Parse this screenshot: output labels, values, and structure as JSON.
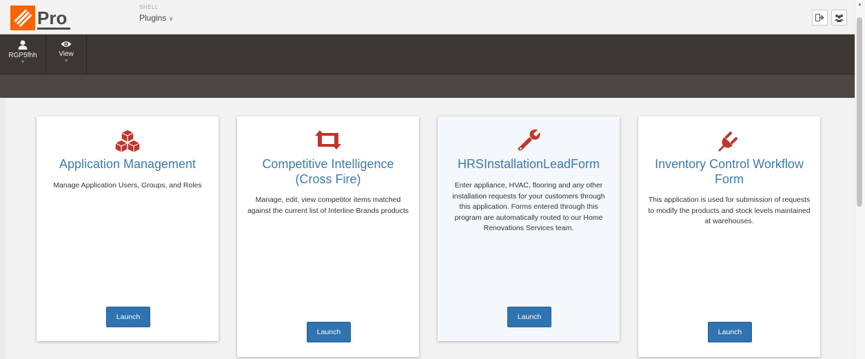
{
  "header": {
    "shell_label": "SHELL",
    "plugins_label": "Plugins",
    "logo_text": "Pro"
  },
  "toolbar": {
    "user_label": "RGP5fhh",
    "view_label": "View"
  },
  "cards": [
    {
      "title": "Application Management",
      "description": "Manage Application Users, Groups, and Roles",
      "launch": "Launch",
      "icon": "cubes-icon"
    },
    {
      "title": "Competitive Intelligence (Cross Fire)",
      "description": "Manage, edit, view competitor items matched against the current list of Interline Brands products",
      "launch": "Launch",
      "icon": "retweet-icon"
    },
    {
      "title": "HRSInstallationLeadForm",
      "description": "Enter appliance, HVAC, flooring and any other installation requests for your customers through this application. Forms entered through this program are automatically routed to our Home Renovations Services team.",
      "launch": "Launch",
      "icon": "wrench-icon"
    },
    {
      "title": "Inventory Control Workflow Form",
      "description": "This application is used for submission of requests to modify the products and stock levels maintained at warehouses.",
      "launch": "Launch",
      "icon": "plug-icon"
    }
  ],
  "colors": {
    "accent": "#c0362c",
    "title_blue": "#3c7aae",
    "button_blue": "#2f73b0",
    "brand_orange": "#f96302"
  }
}
